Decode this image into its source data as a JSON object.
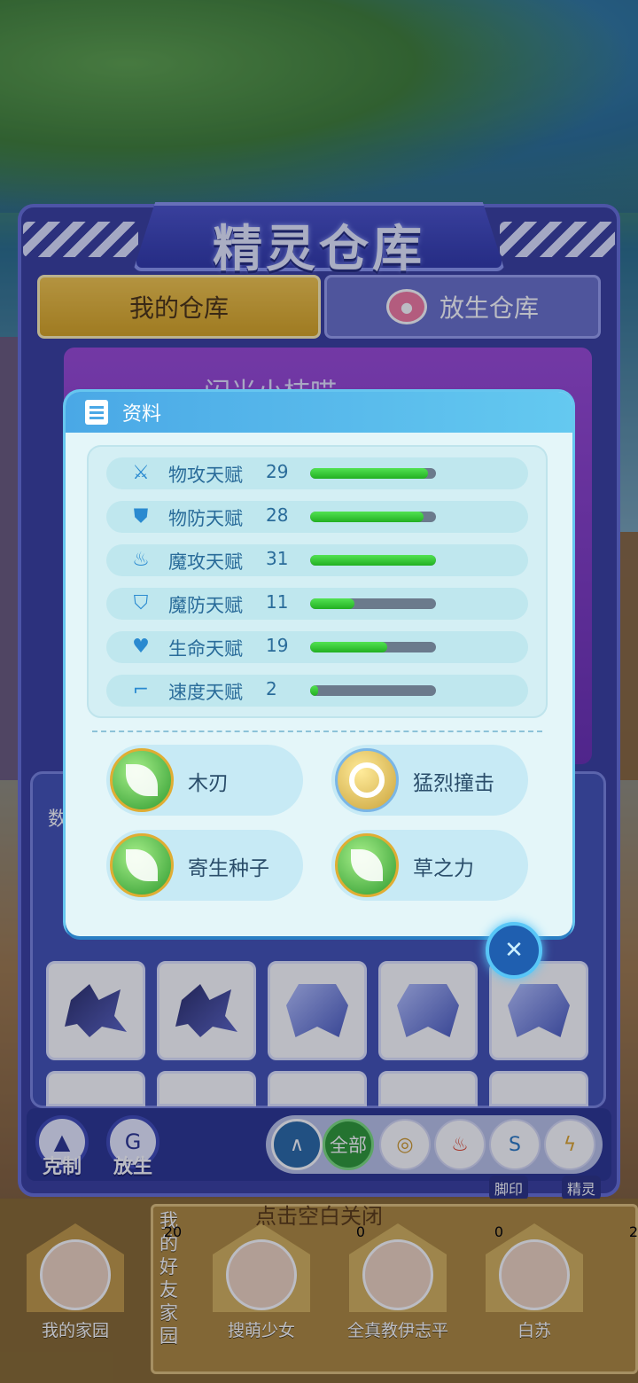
{
  "header": {
    "title": "精灵仓库"
  },
  "tabs": [
    {
      "label": "我的仓库",
      "active": true
    },
    {
      "label": "放生仓库",
      "active": false
    }
  ],
  "pet": {
    "name": "闪光小桔喵"
  },
  "grid": {
    "label": "数"
  },
  "info_modal": {
    "title": "资料",
    "stats": [
      {
        "label": "物攻天赋",
        "value": "29",
        "level": 0.94,
        "icon": "sword-icon"
      },
      {
        "label": "物防天赋",
        "value": "28",
        "level": 0.9,
        "icon": "shield-icon"
      },
      {
        "label": "魔攻天赋",
        "value": "31",
        "level": 1.0,
        "icon": "flame-icon"
      },
      {
        "label": "魔防天赋",
        "value": "11",
        "level": 0.35,
        "icon": "magic-shield-icon"
      },
      {
        "label": "生命天赋",
        "value": "19",
        "level": 0.61,
        "icon": "heart-plus-icon"
      },
      {
        "label": "速度天赋",
        "value": "2",
        "level": 0.06,
        "icon": "boot-icon"
      }
    ],
    "skills": [
      {
        "name": "木刃",
        "type": "grass"
      },
      {
        "name": "猛烈撞击",
        "type": "normal"
      },
      {
        "name": "寄生种子",
        "type": "grass"
      },
      {
        "name": "草之力",
        "type": "grass"
      }
    ]
  },
  "toolbar": {
    "counter_label": "克制",
    "release_label": "放生",
    "filter_all": "全部",
    "tag_footprint": "脚印",
    "tag_spirit": "精灵"
  },
  "close_hint": "点击空白关闭",
  "friends": {
    "vertical_label": "我的好友家园",
    "items": [
      {
        "name": "我的家园",
        "count": "20"
      },
      {
        "name": "搜萌少女",
        "count": "0"
      },
      {
        "name": "全真教伊志平",
        "count": "0"
      },
      {
        "name": "白苏",
        "count": "2"
      }
    ]
  },
  "colors": {
    "accent_blue": "#4aa8e6",
    "bar_green": "#22b022",
    "tab_gold": "#f5c74a"
  }
}
